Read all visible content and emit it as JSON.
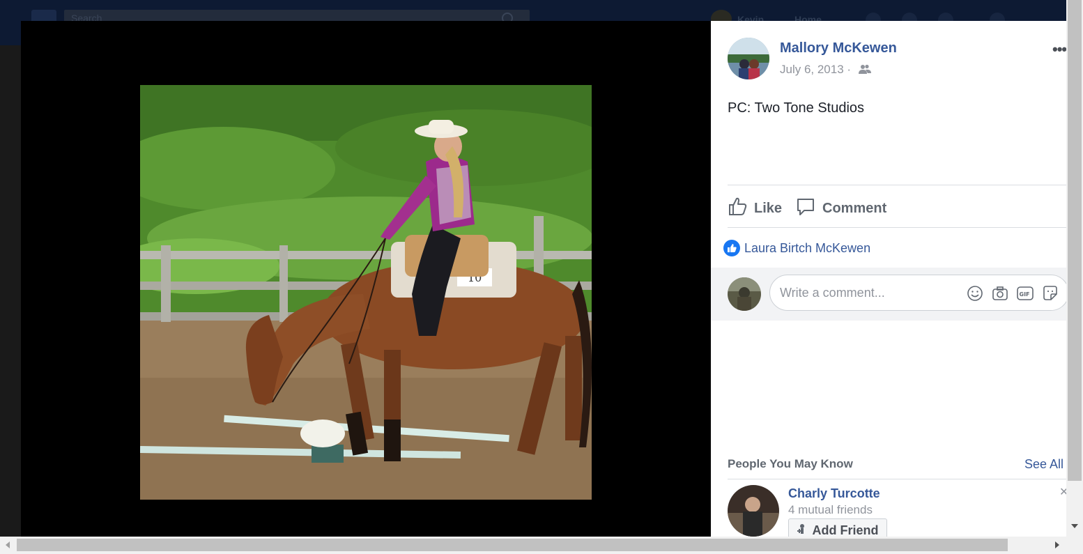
{
  "background": {
    "search_placeholder": "Search",
    "user_name": "Kevin",
    "home_label": "Home"
  },
  "post": {
    "author": "Mallory McKewen",
    "date": "July 6, 2013 ·",
    "privacy_icon": "friends-icon",
    "caption": "PC: Two Tone Studios",
    "more_label": "•••",
    "photo_number_label": "10"
  },
  "actions": {
    "like_label": "Like",
    "comment_label": "Comment"
  },
  "reactions": {
    "reactor": "Laura Birtch McKewen"
  },
  "comment_box": {
    "placeholder": "Write a comment...",
    "icons": [
      "emoji-icon",
      "camera-icon",
      "gif-icon",
      "sticker-icon"
    ],
    "gif_text": "GIF"
  },
  "people_you_may_know": {
    "title": "People You May Know",
    "see_all": "See All",
    "person": {
      "name": "Charly Turcotte",
      "mutual": "4 mutual friends",
      "add_friend_label": "Add Friend"
    }
  },
  "colors": {
    "link_blue": "#365899",
    "like_blue": "#1877f2",
    "muted_gray": "#90949c"
  }
}
